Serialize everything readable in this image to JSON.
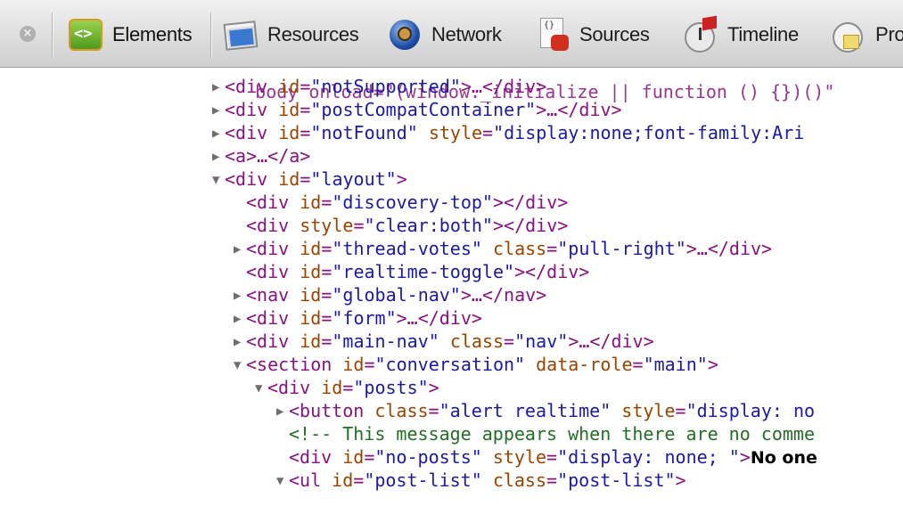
{
  "toolbar": {
    "close_glyph": "×",
    "tabs": [
      {
        "label": "Elements",
        "icon": "elements-icon",
        "active": true
      },
      {
        "label": "Resources",
        "icon": "resources-icon"
      },
      {
        "label": "Network",
        "icon": "network-icon"
      },
      {
        "label": "Sources",
        "icon": "sources-icon"
      },
      {
        "label": "Timeline",
        "icon": "timeline-icon"
      },
      {
        "label": "Pro",
        "icon": "profiles-icon"
      }
    ]
  },
  "code": {
    "top_partial": "body onload=\"(window._initialize || function () {})()\"",
    "lines": [
      {
        "tri": "▶",
        "parts": [
          [
            "tag",
            "<div "
          ],
          [
            "an",
            "id"
          ],
          [
            "pn",
            "="
          ],
          [
            "av",
            "\"notSupported\""
          ],
          [
            "tag",
            ">…</div>"
          ]
        ]
      },
      {
        "tri": "▶",
        "parts": [
          [
            "tag",
            "<div "
          ],
          [
            "an",
            "id"
          ],
          [
            "pn",
            "="
          ],
          [
            "av",
            "\"postCompatContainer\""
          ],
          [
            "tag",
            ">…</div>"
          ]
        ]
      },
      {
        "tri": "▶",
        "parts": [
          [
            "tag",
            "<div "
          ],
          [
            "an",
            "id"
          ],
          [
            "pn",
            "="
          ],
          [
            "av",
            "\"notFound\""
          ],
          [
            "tag",
            " "
          ],
          [
            "an",
            "style"
          ],
          [
            "pn",
            "="
          ],
          [
            "av",
            "\"display:none;font-family:Ari"
          ]
        ]
      },
      {
        "tri": "▶",
        "parts": [
          [
            "tag",
            "<a>…</a>"
          ]
        ]
      },
      {
        "tri": "▼",
        "parts": [
          [
            "tag",
            "<div "
          ],
          [
            "an",
            "id"
          ],
          [
            "pn",
            "="
          ],
          [
            "av",
            "\"layout\""
          ],
          [
            "tag",
            ">"
          ]
        ]
      },
      {
        "tri": "",
        "parts": [
          [
            "tag",
            "<div "
          ],
          [
            "an",
            "id"
          ],
          [
            "pn",
            "="
          ],
          [
            "av",
            "\"discovery-top\""
          ],
          [
            "tag",
            "></div>"
          ]
        ]
      },
      {
        "tri": "",
        "parts": [
          [
            "tag",
            "<div "
          ],
          [
            "an",
            "style"
          ],
          [
            "pn",
            "="
          ],
          [
            "av",
            "\"clear:both\""
          ],
          [
            "tag",
            "></div>"
          ]
        ]
      },
      {
        "tri": "▶",
        "parts": [
          [
            "tag",
            "<div "
          ],
          [
            "an",
            "id"
          ],
          [
            "pn",
            "="
          ],
          [
            "av",
            "\"thread-votes\""
          ],
          [
            "tag",
            " "
          ],
          [
            "an",
            "class"
          ],
          [
            "pn",
            "="
          ],
          [
            "av",
            "\"pull-right\""
          ],
          [
            "tag",
            ">…</div>"
          ]
        ]
      },
      {
        "tri": "",
        "parts": [
          [
            "tag",
            "<div "
          ],
          [
            "an",
            "id"
          ],
          [
            "pn",
            "="
          ],
          [
            "av",
            "\"realtime-toggle\""
          ],
          [
            "tag",
            "></div>"
          ]
        ]
      },
      {
        "tri": "▶",
        "parts": [
          [
            "tag",
            "<nav "
          ],
          [
            "an",
            "id"
          ],
          [
            "pn",
            "="
          ],
          [
            "av",
            "\"global-nav\""
          ],
          [
            "tag",
            ">…</nav>"
          ]
        ]
      },
      {
        "tri": "▶",
        "parts": [
          [
            "tag",
            "<div "
          ],
          [
            "an",
            "id"
          ],
          [
            "pn",
            "="
          ],
          [
            "av",
            "\"form\""
          ],
          [
            "tag",
            ">…</div>"
          ]
        ]
      },
      {
        "tri": "▶",
        "parts": [
          [
            "tag",
            "<div "
          ],
          [
            "an",
            "id"
          ],
          [
            "pn",
            "="
          ],
          [
            "av",
            "\"main-nav\""
          ],
          [
            "tag",
            " "
          ],
          [
            "an",
            "class"
          ],
          [
            "pn",
            "="
          ],
          [
            "av",
            "\"nav\""
          ],
          [
            "tag",
            ">…</div>"
          ]
        ]
      },
      {
        "tri": "▼",
        "parts": [
          [
            "tag",
            "<section "
          ],
          [
            "an",
            "id"
          ],
          [
            "pn",
            "="
          ],
          [
            "av",
            "\"conversation\""
          ],
          [
            "tag",
            " "
          ],
          [
            "an",
            "data-role"
          ],
          [
            "pn",
            "="
          ],
          [
            "av",
            "\"main\""
          ],
          [
            "tag",
            ">"
          ]
        ]
      },
      {
        "tri": "▼",
        "parts": [
          [
            "tag",
            "<div "
          ],
          [
            "an",
            "id"
          ],
          [
            "pn",
            "="
          ],
          [
            "av",
            "\"posts\""
          ],
          [
            "tag",
            ">"
          ]
        ]
      },
      {
        "tri": "▶",
        "parts": [
          [
            "tag",
            "<button "
          ],
          [
            "an",
            "class"
          ],
          [
            "pn",
            "="
          ],
          [
            "av",
            "\"alert realtime\""
          ],
          [
            "tag",
            " "
          ],
          [
            "an",
            "style"
          ],
          [
            "pn",
            "="
          ],
          [
            "av",
            "\"display: no"
          ]
        ]
      },
      {
        "tri": "",
        "parts": [
          [
            "cm",
            "<!-- This message appears when there are no comme"
          ]
        ]
      },
      {
        "tri": "",
        "parts": [
          [
            "tag",
            "<div "
          ],
          [
            "an",
            "id"
          ],
          [
            "pn",
            "="
          ],
          [
            "av",
            "\"no-posts\""
          ],
          [
            "tag",
            " "
          ],
          [
            "an",
            "style"
          ],
          [
            "pn",
            "="
          ],
          [
            "av",
            "\"display: none; \""
          ],
          [
            "tag",
            ">"
          ],
          [
            "tx",
            "No one"
          ]
        ]
      },
      {
        "tri": "▼",
        "parts": [
          [
            "tag",
            "<ul "
          ],
          [
            "an",
            "id"
          ],
          [
            "pn",
            "="
          ],
          [
            "av",
            "\"post-list\""
          ],
          [
            "tag",
            " "
          ],
          [
            "an",
            "class"
          ],
          [
            "pn",
            "="
          ],
          [
            "av",
            "\"post-list\""
          ],
          [
            "tag",
            ">"
          ]
        ]
      }
    ]
  }
}
